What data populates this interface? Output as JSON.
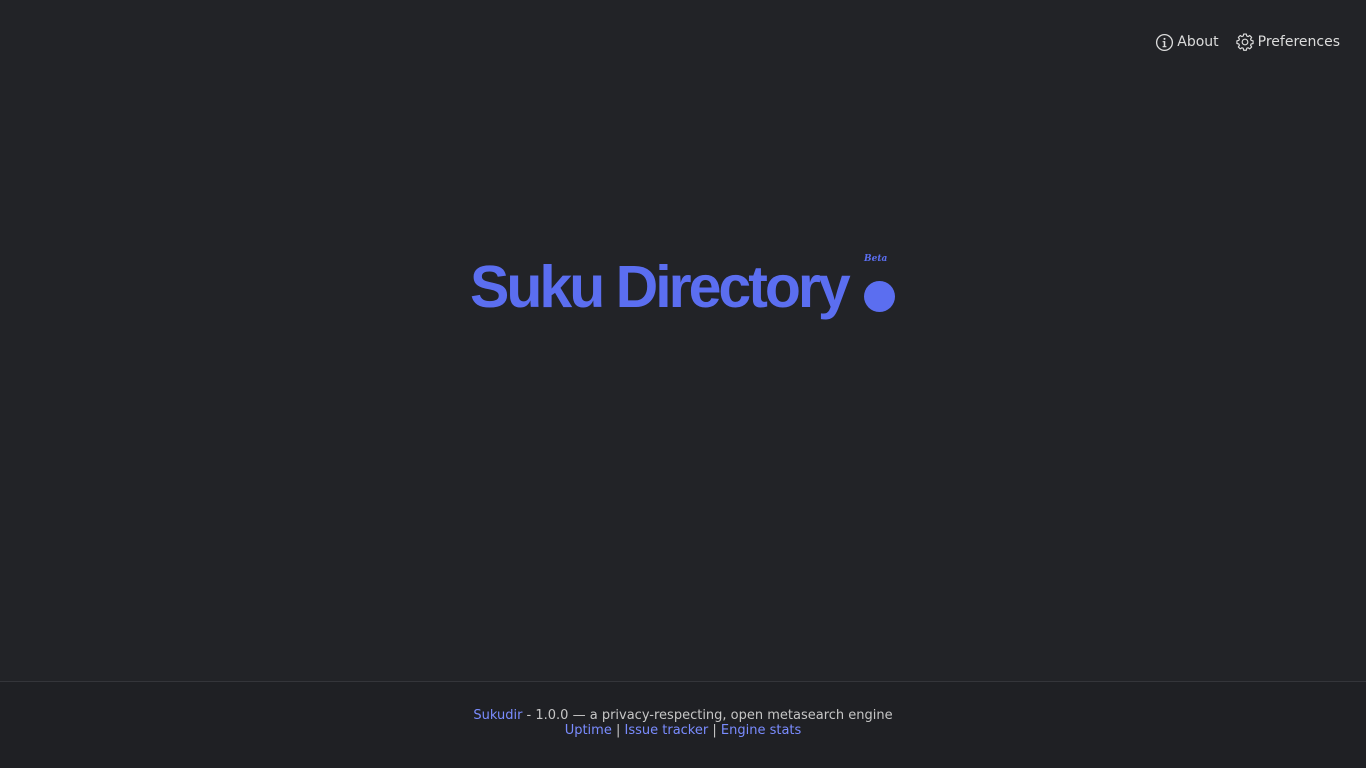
{
  "nav": {
    "about": {
      "label": "About",
      "icon": "info-icon"
    },
    "preferences": {
      "label": "Preferences",
      "icon": "gear-icon"
    }
  },
  "logo": {
    "text": "Suku Directory",
    "badge": "Beta",
    "color": "#5b6ef0"
  },
  "footer": {
    "brand_link": "Sukudir",
    "tagline": " - 1.0.0 — a privacy-respecting, open metasearch engine",
    "links": [
      "Uptime",
      "Issue tracker",
      "Engine stats"
    ],
    "separator": "|"
  },
  "colors": {
    "background": "#222327",
    "footer_background": "#1f2024",
    "link": "#7a8cff",
    "text": "#dcdcdc"
  }
}
